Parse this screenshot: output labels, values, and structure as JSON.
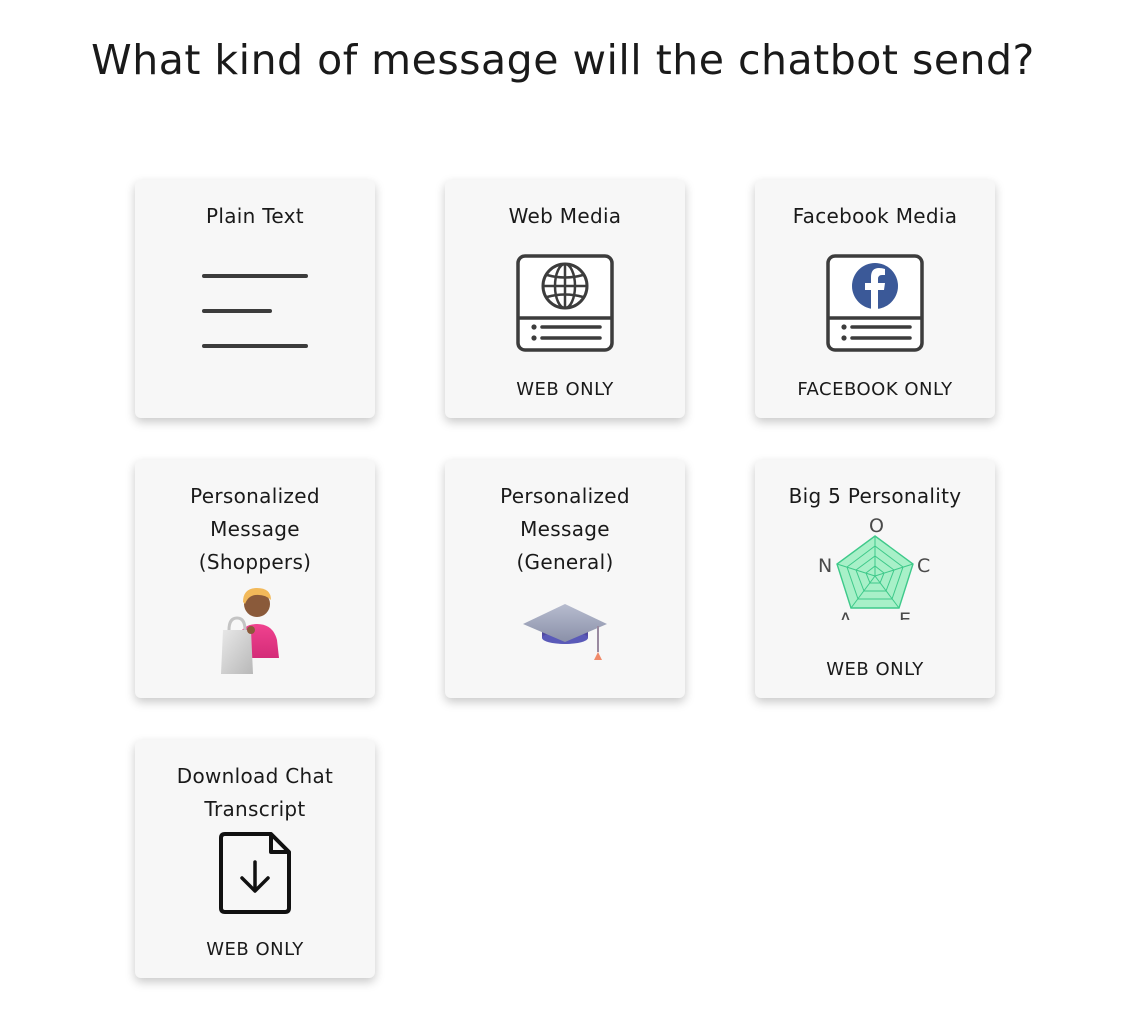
{
  "page": {
    "title": "What kind of message will the chatbot send?"
  },
  "cards": [
    {
      "title": "Plain Text",
      "note": "",
      "icon": "text-lines-icon"
    },
    {
      "title": "Web Media",
      "note": "WEB ONLY",
      "icon": "globe-media-icon"
    },
    {
      "title": "Facebook Media",
      "note": "FACEBOOK ONLY",
      "icon": "facebook-media-icon"
    },
    {
      "title": "Personalized\nMessage\n(Shoppers)",
      "note": "",
      "icon": "shopper-icon"
    },
    {
      "title": "Personalized\nMessage\n(General)",
      "note": "",
      "icon": "graduation-cap-icon"
    },
    {
      "title": "Big 5 Personality",
      "note": "WEB ONLY",
      "icon": "radar-chart-icon"
    },
    {
      "title": "Download Chat\nTranscript",
      "note": "WEB ONLY",
      "icon": "download-file-icon"
    }
  ],
  "radar": {
    "labels": [
      "O",
      "C",
      "E",
      "A",
      "N"
    ],
    "fill_color": "#a8f0c8",
    "stroke_color": "#3ec98a"
  },
  "colors": {
    "facebook_blue": "#3b5998",
    "card_background": "#f7f7f7",
    "shopper_shirt": "#e63b8a"
  }
}
